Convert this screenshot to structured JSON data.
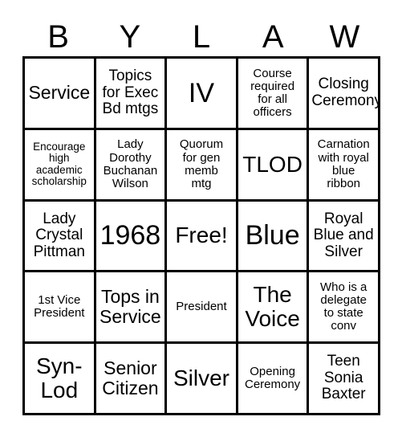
{
  "card": {
    "title": "BYLAW Bingo Card",
    "header_letters": [
      "B",
      "Y",
      "L",
      "A",
      "W"
    ],
    "columns": 5,
    "rows": 5,
    "border_color": "#000000",
    "background_color": "#ffffff",
    "text_color": "#000000",
    "cells": [
      [
        {
          "text": "Service",
          "size": "lg"
        },
        {
          "text": "Topics\nfor Exec\nBd mtgs",
          "size": "md"
        },
        {
          "text": "IV",
          "size": "xxl"
        },
        {
          "text": "Course\nrequired\nfor all\nofficers",
          "size": "sm"
        },
        {
          "text": "Closing\nCeremony",
          "size": "md"
        }
      ],
      [
        {
          "text": "Encourage\nhigh\nacademic\nscholarship",
          "size": "xs"
        },
        {
          "text": "Lady\nDorothy\nBuchanan\nWilson",
          "size": "sm"
        },
        {
          "text": "Quorum\nfor gen\nmemb\nmtg",
          "size": "sm"
        },
        {
          "text": "TLOD",
          "size": "xl"
        },
        {
          "text": "Carnation\nwith royal\nblue\nribbon",
          "size": "sm"
        }
      ],
      [
        {
          "text": "Lady\nCrystal\nPittman",
          "size": "md"
        },
        {
          "text": "1968",
          "size": "xxl"
        },
        {
          "text": "Free!",
          "size": "xl"
        },
        {
          "text": "Blue",
          "size": "xxl"
        },
        {
          "text": "Royal\nBlue and\nSilver",
          "size": "md"
        }
      ],
      [
        {
          "text": "1st Vice\nPresident",
          "size": "sm"
        },
        {
          "text": "Tops in\nService",
          "size": "lg"
        },
        {
          "text": "President",
          "size": "sm"
        },
        {
          "text": "The\nVoice",
          "size": "xl"
        },
        {
          "text": "Who is a\ndelegate\nto state\nconv",
          "size": "sm"
        }
      ],
      [
        {
          "text": "Syn-\nLod",
          "size": "xl"
        },
        {
          "text": "Senior\nCitizen",
          "size": "lg"
        },
        {
          "text": "Silver",
          "size": "xl"
        },
        {
          "text": "Opening\nCeremony",
          "size": "sm"
        },
        {
          "text": "Teen\nSonia\nBaxter",
          "size": "md"
        }
      ]
    ]
  }
}
